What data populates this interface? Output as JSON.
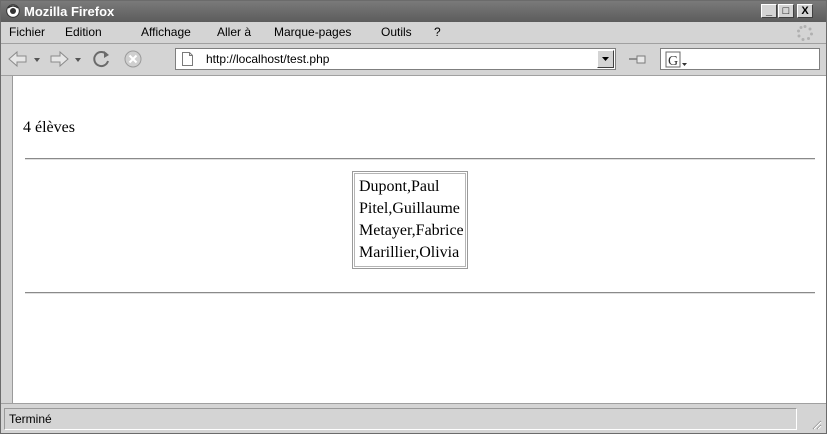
{
  "window": {
    "title": "Mozilla Firefox",
    "controls": {
      "minimize": "_",
      "maximize": "□",
      "close": "X"
    }
  },
  "menu": [
    "Fichier",
    "Edition",
    "Affichage",
    "Aller à",
    "Marque-pages",
    "Outils",
    "?"
  ],
  "toolbar": {
    "url": "http://localhost/test.php",
    "icons": [
      "back-arrow-icon",
      "forward-arrow-icon",
      "reload-icon",
      "stop-icon",
      "page-icon",
      "go-icon",
      "google-search-icon"
    ]
  },
  "page": {
    "count_text": "4 élèves",
    "students": [
      "Dupont,Paul",
      "Pitel,Guillaume",
      "Metayer,Fabrice",
      "Marillier,Olivia"
    ]
  },
  "status": {
    "text": "Terminé"
  },
  "colors": {
    "titlebar": "#6a6a6a",
    "chrome": "#d4d4d4",
    "content_bg": "#ffffff"
  }
}
